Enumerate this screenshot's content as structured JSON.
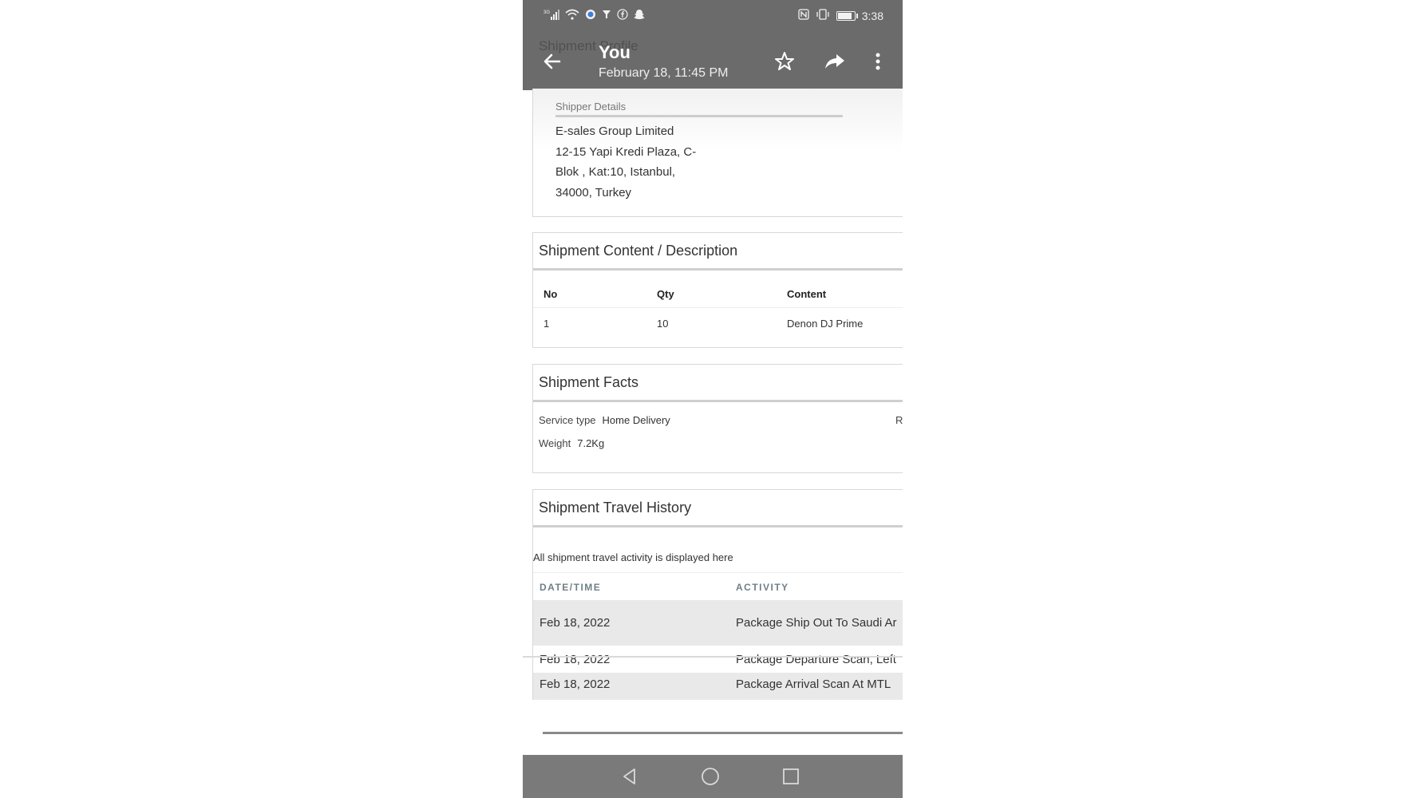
{
  "status_bar": {
    "signal": "3G",
    "time": "3:38",
    "battery_level": 0.85,
    "icons": [
      "signal-icon",
      "wifi-icon",
      "vpn-icon",
      "filter-icon",
      "facebook-icon",
      "snapchat-icon",
      "nfc-icon",
      "vibrate-icon",
      "battery-icon"
    ]
  },
  "toolbar": {
    "background_title": "Shipment Profile",
    "sender": "You",
    "timestamp": "February 18, 11:45 PM",
    "icons": [
      "back-arrow-icon",
      "star-icon",
      "share-icon",
      "more-vert-icon"
    ]
  },
  "shipper": {
    "label": "Shipper Details",
    "address_lines": [
      "E-sales Group Limited",
      "12-15 Yapi Kredi Plaza, C-",
      "Blok , Kat:10, Istanbul,",
      "34000, Turkey"
    ]
  },
  "shipment_content": {
    "title": "Shipment Content / Description",
    "headers": [
      "No",
      "Qty",
      "Content"
    ],
    "rows": [
      [
        "1",
        "10",
        "Denon DJ Prime"
      ]
    ]
  },
  "shipment_facts": {
    "title": "Shipment Facts",
    "service_type_label": "Service type",
    "service_type_value": "Home Delivery",
    "weight_label": "Weight",
    "weight_value": "7.2Kg",
    "truncated_label": "R"
  },
  "travel_history": {
    "title": "Shipment Travel History",
    "note": "All shipment travel activity is displayed here",
    "headers": [
      "DATE/TIME",
      "ACTIVITY"
    ],
    "rows": [
      {
        "date": "Feb 18, 2022",
        "activity": "Package Ship Out To Saudi Ar"
      },
      {
        "date": "Feb 18, 2022",
        "activity": "Package Departure Scan, Left"
      },
      {
        "date": "Feb 18, 2022",
        "activity": "Package Arrival Scan At MTL"
      }
    ]
  },
  "nav_bar": {
    "icons": [
      "back-triangle-icon",
      "home-circle-icon",
      "recents-square-icon"
    ]
  },
  "colors": {
    "bar_gray": "#6b6b6b",
    "nav_gray": "#7a7a7a",
    "header_text": "#333333",
    "column_header": "#6f7f87",
    "row_highlight": "#e9e9e9"
  }
}
